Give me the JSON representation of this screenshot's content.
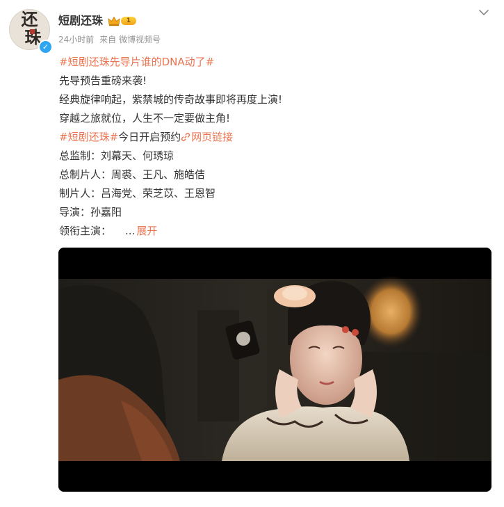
{
  "user": {
    "name": "短剧还珠",
    "vip_level": "1",
    "avatar_text": [
      "还",
      "珠"
    ],
    "verified_mark": "✓"
  },
  "meta": {
    "time": "24小时前",
    "source_prefix": "来自",
    "source": "微博视频号"
  },
  "post": {
    "line1_hashtag": "#短剧还珠先导片谁的DNA动了#",
    "line2": "先导预告重磅来袭!",
    "line3": "经典旋律响起，紫禁城的传奇故事即将再度上演!",
    "line4": "穿越之旅就位，人生不一定要做主角!",
    "line5_hashtag": "#短剧还珠#",
    "line5_text": "今日开启预约",
    "line5_link": "网页链接",
    "line6": "总监制：刘幕天、何琇琼",
    "line7": "总制片人：周裘、王凡、施皓佶",
    "line8": "制片人：吕海党、荣芝苡、王恩智",
    "line9": "导演：孙嘉阳",
    "line10": "领衔主演：",
    "ellipsis": "...",
    "expand_label": "展开"
  },
  "colors": {
    "accent": "#eb7350",
    "text": "#333333",
    "meta": "#939393",
    "verified": "#2ea5f0"
  },
  "icons": {
    "verified": "verified-badge-icon",
    "vip": "crown-icon",
    "link": "link-icon",
    "menu": "chevron-down-icon"
  }
}
